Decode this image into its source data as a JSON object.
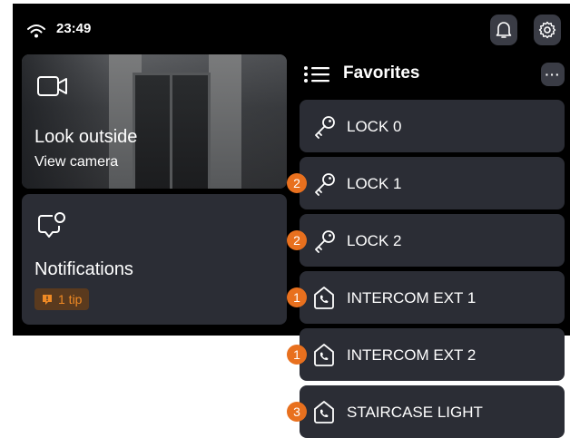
{
  "status": {
    "time": "23:49",
    "wifi_icon": "wifi-icon",
    "bell_icon": "bell-icon",
    "gear_icon": "gear-icon"
  },
  "camera_card": {
    "icon": "video-camera-icon",
    "title": "Look outside",
    "subtitle": "View camera"
  },
  "notifications_card": {
    "icon": "chat-bubble-icon",
    "title": "Notifications",
    "tip_label": "1 tip",
    "tip_icon": "exclamation-bubble-icon"
  },
  "favorites": {
    "title": "Favorites",
    "more_label": "···",
    "items": [
      {
        "label": "LOCK 0",
        "icon": "key-icon",
        "badge": ""
      },
      {
        "label": "LOCK 1",
        "icon": "key-icon",
        "badge": "2"
      },
      {
        "label": "LOCK 2",
        "icon": "key-icon",
        "badge": "2"
      },
      {
        "label": "INTERCOM EXT 1",
        "icon": "phone-house-icon",
        "badge": "1"
      },
      {
        "label": "INTERCOM EXT 2",
        "icon": "phone-house-icon",
        "badge": "1"
      },
      {
        "label": "STAIRCASE LIGHT",
        "icon": "phone-house-icon",
        "badge": "3"
      }
    ]
  },
  "colors": {
    "background": "#000000",
    "card": "#2b2d35",
    "accent": "#e8701e",
    "tip_bg": "#5a3a1e"
  }
}
